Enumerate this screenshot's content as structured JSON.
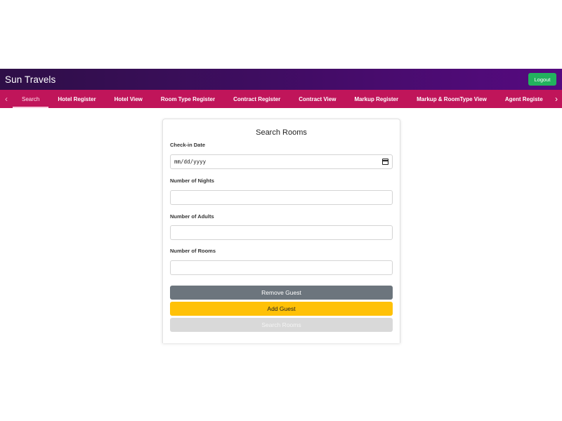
{
  "header": {
    "brand": "Sun Travels",
    "logout_label": "Logout"
  },
  "nav": {
    "items": [
      {
        "label": "Search",
        "active": true
      },
      {
        "label": "Hotel Register"
      },
      {
        "label": "Hotel View"
      },
      {
        "label": "Room Type Register"
      },
      {
        "label": "Contract Register"
      },
      {
        "label": "Contract View"
      },
      {
        "label": "Markup Register"
      },
      {
        "label": "Markup & RoomType View"
      },
      {
        "label": "Agent Registe"
      }
    ],
    "left_icon": "chevron-left-icon",
    "right_icon": "chevron-right-icon"
  },
  "form": {
    "title": "Search Rooms",
    "checkin_label": "Check-in Date",
    "checkin_value": "mm/dd/yyyy",
    "nights_label": "Number of Nights",
    "nights_value": "",
    "adults_label": "Number of Adults",
    "adults_value": "",
    "rooms_label": "Number of Rooms",
    "rooms_value": "",
    "remove_guest_label": "Remove Guest",
    "add_guest_label": "Add Guest",
    "search_label": "Search Rooms"
  },
  "colors": {
    "header_gradient_start": "#2e0f47",
    "header_gradient_end": "#560a80",
    "nav_bg": "#c0155a",
    "logout_bg": "#22b25e",
    "remove_bg": "#6c757d",
    "add_bg": "#ffc107",
    "search_disabled_bg": "#d9d9d9"
  }
}
